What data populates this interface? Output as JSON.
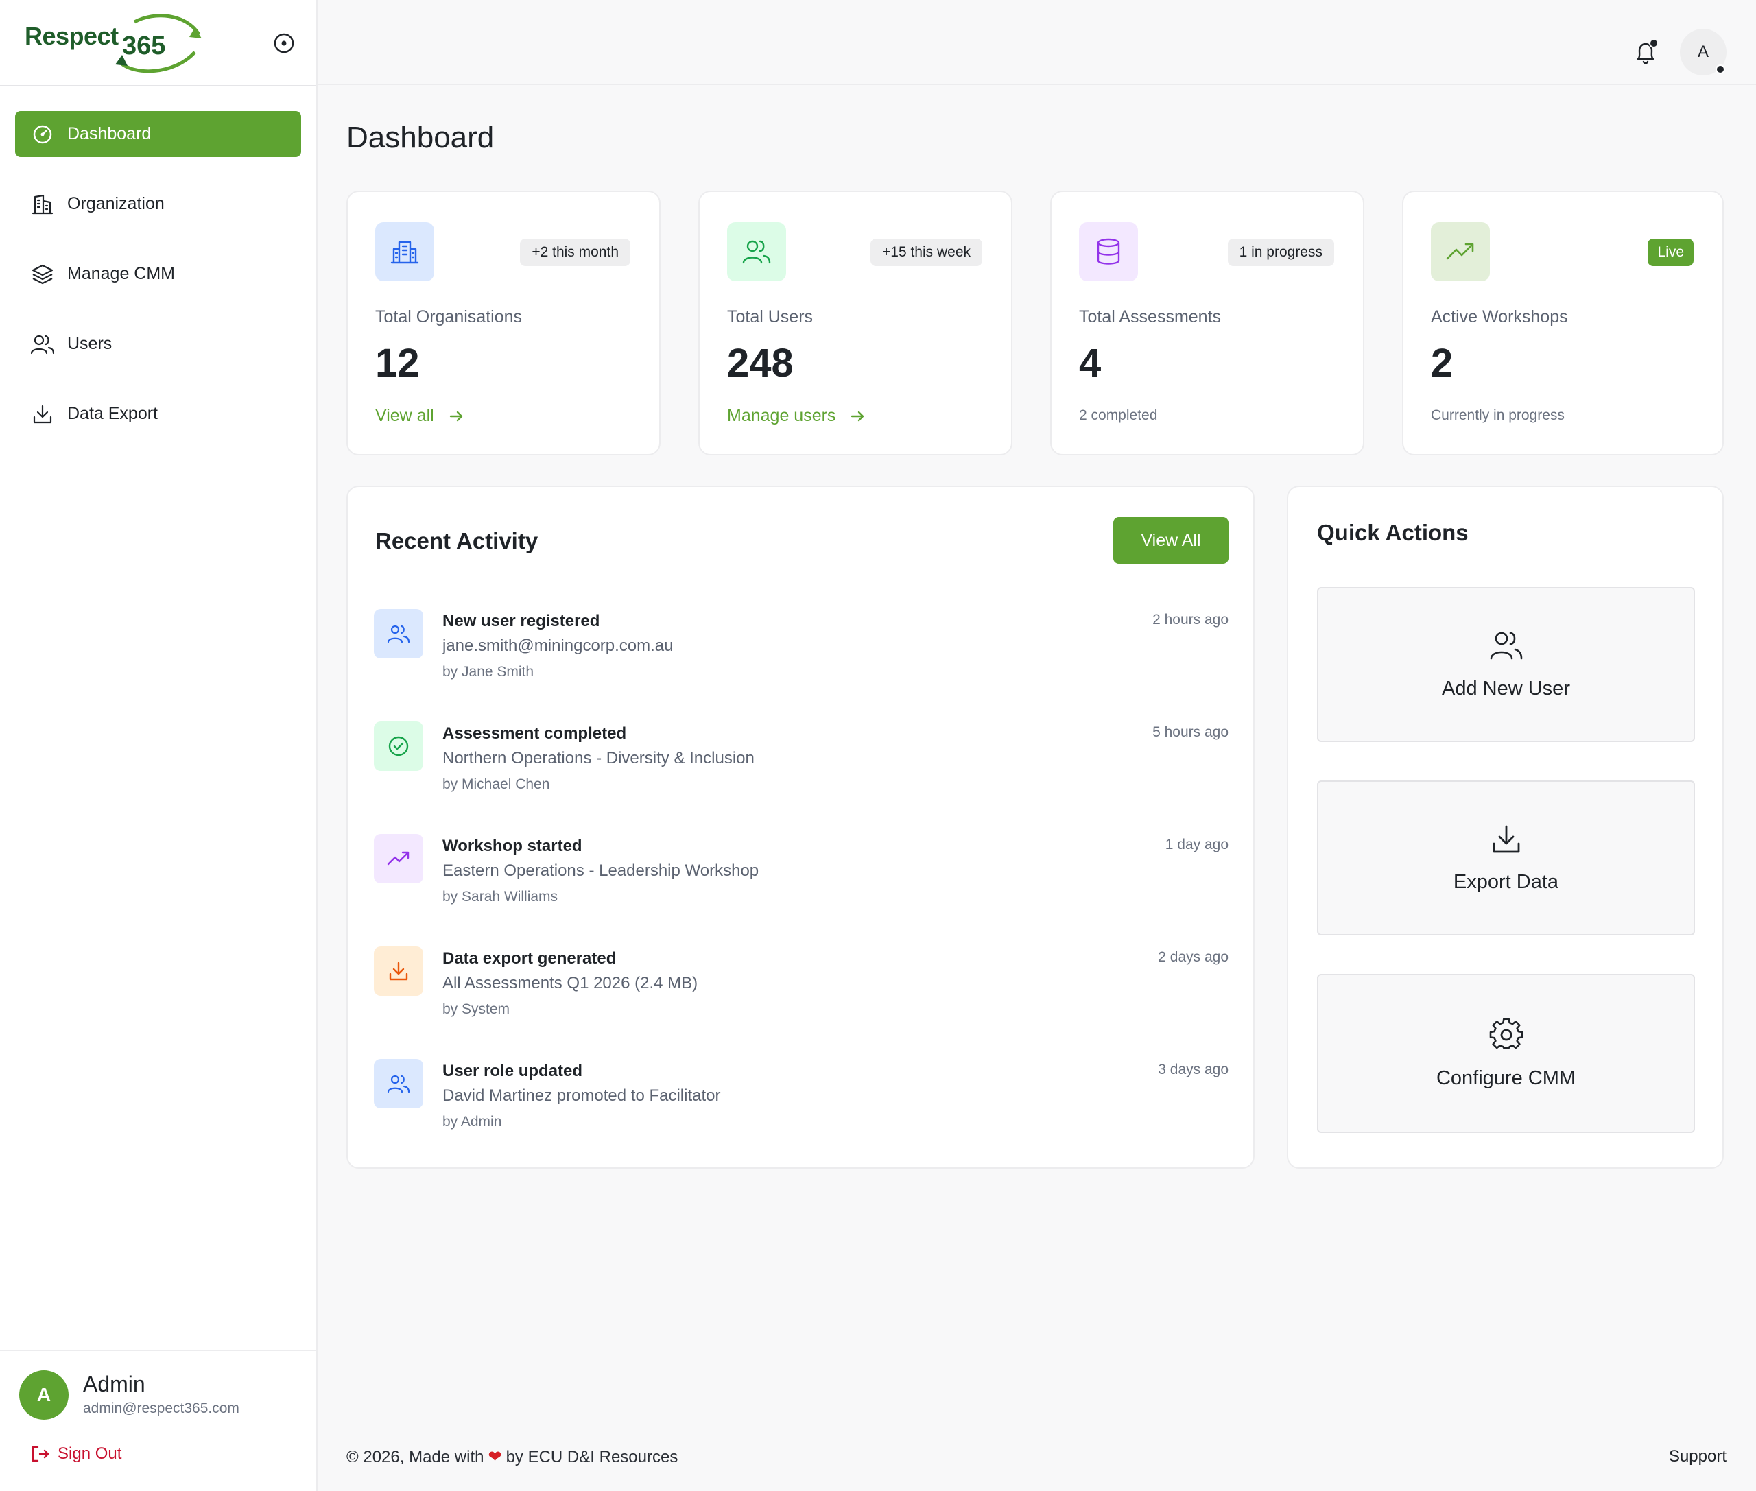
{
  "brand": {
    "name_a": "Respect",
    "name_b": "365"
  },
  "nav": {
    "items": [
      {
        "label": "Dashboard",
        "icon": "gauge-icon",
        "active": true
      },
      {
        "label": "Organization",
        "icon": "building-icon"
      },
      {
        "label": "Manage CMM",
        "icon": "layers-icon"
      },
      {
        "label": "Users",
        "icon": "users-icon"
      },
      {
        "label": "Data Export",
        "icon": "download-icon"
      }
    ]
  },
  "user": {
    "initial": "A",
    "name": "Admin",
    "email": "admin@respect365.com",
    "signout_label": "Sign Out"
  },
  "topbar": {
    "avatar_initial": "A"
  },
  "page": {
    "title": "Dashboard"
  },
  "stats": [
    {
      "label": "Total Organisations",
      "value": "12",
      "badge": "+2 this month",
      "link": "View all",
      "icon": "building-icon",
      "color": "#2563eb",
      "bg": "#dbe8fe"
    },
    {
      "label": "Total Users",
      "value": "248",
      "badge": "+15 this week",
      "link": "Manage users",
      "icon": "users-icon",
      "color": "#16a34a",
      "bg": "#dcfce7"
    },
    {
      "label": "Total Assessments",
      "value": "4",
      "badge": "1 in progress",
      "sub": "2 completed",
      "icon": "database-icon",
      "color": "#9333ea",
      "bg": "#f3e8ff"
    },
    {
      "label": "Active Workshops",
      "value": "2",
      "badge": "Live",
      "sub": "Currently in progress",
      "icon": "trending-up-icon",
      "color": "#5ea331",
      "bg": "#e3efd9"
    }
  ],
  "recent_activity": {
    "title": "Recent Activity",
    "view_all_label": "View All",
    "items": [
      {
        "title": "New user registered",
        "desc": "jane.smith@miningcorp.com.au",
        "by": "by Jane Smith",
        "time": "2 hours ago",
        "icon": "users-icon",
        "color": "#2563eb",
        "bg": "#dbe8fe"
      },
      {
        "title": "Assessment completed",
        "desc": "Northern Operations - Diversity & Inclusion",
        "by": "by Michael Chen",
        "time": "5 hours ago",
        "icon": "check-circle-icon",
        "color": "#16a34a",
        "bg": "#dcfce7"
      },
      {
        "title": "Workshop started",
        "desc": "Eastern Operations - Leadership Workshop",
        "by": "by Sarah Williams",
        "time": "1 day ago",
        "icon": "trending-up-icon",
        "color": "#9333ea",
        "bg": "#f3e8ff"
      },
      {
        "title": "Data export generated",
        "desc": "All Assessments Q1 2026 (2.4 MB)",
        "by": "by System",
        "time": "2 days ago",
        "icon": "download-icon",
        "color": "#ea580c",
        "bg": "#ffedd5"
      },
      {
        "title": "User role updated",
        "desc": "David Martinez promoted to Facilitator",
        "by": "by Admin",
        "time": "3 days ago",
        "icon": "users-icon",
        "color": "#2563eb",
        "bg": "#dbe8fe"
      }
    ]
  },
  "quick_actions": {
    "title": "Quick Actions",
    "items": [
      {
        "label": "Add New User",
        "icon": "users-icon"
      },
      {
        "label": "Export Data",
        "icon": "download-icon"
      },
      {
        "label": "Configure CMM",
        "icon": "gear-icon"
      }
    ]
  },
  "footer": {
    "left_a": "© 2026, Made with",
    "left_b": "by ECU D&I Resources",
    "right": "Support"
  }
}
